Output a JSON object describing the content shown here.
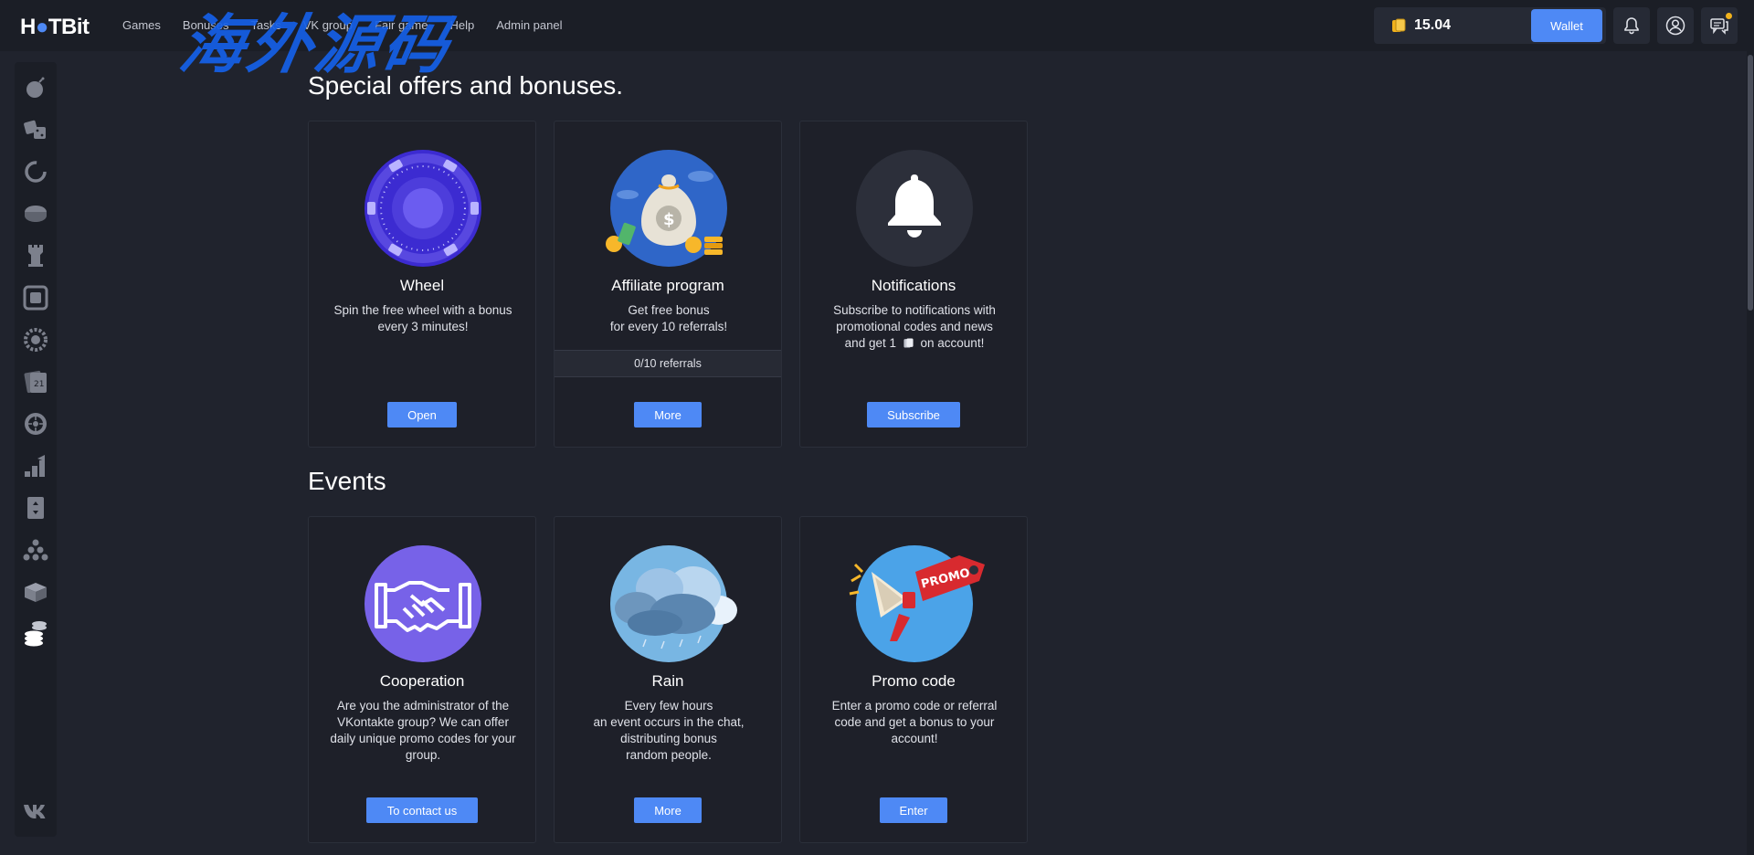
{
  "header": {
    "logo_text_a": "H",
    "logo_text_b": "TBit",
    "nav": [
      "Games",
      "Bonuses",
      "Tasks",
      "VK group",
      "Fair game",
      "Help",
      "Admin panel"
    ],
    "watermark": "海外源码",
    "balance": "15.04",
    "wallet_label": "Wallet",
    "icons": [
      "bell-icon",
      "user-icon",
      "chat-icon"
    ]
  },
  "sidebar": {
    "items": [
      "bomb-icon",
      "dice-icon",
      "crash-icon",
      "coin-icon",
      "tower-icon",
      "keno-icon",
      "wheel-icon",
      "blackjack-icon",
      "roulette-icon",
      "stairs-icon",
      "hilo-icon",
      "plinko-icon",
      "box-icon",
      "coins-icon"
    ],
    "footer": "vk-icon"
  },
  "offers": {
    "title": "Special offers and bonuses.",
    "cards": [
      {
        "title": "Wheel",
        "desc": [
          "Spin the free wheel with a bonus",
          "every 3 minutes!"
        ],
        "button": "Open"
      },
      {
        "title": "Affiliate program",
        "desc": [
          "Get free bonus",
          "for every 10 referrals!"
        ],
        "progress": "0/10 referrals",
        "button": "More"
      },
      {
        "title": "Notifications",
        "desc": [
          "Subscribe to notifications with promotional codes and news",
          "and get 1",
          "on account!"
        ],
        "button": "Subscribe"
      }
    ]
  },
  "events": {
    "title": "Events",
    "cards": [
      {
        "title": "Cooperation",
        "desc": [
          "Are you the administrator of the VKontakte group? We can offer daily unique promo codes for your group."
        ],
        "button": "To contact us"
      },
      {
        "title": "Rain",
        "desc": [
          "Every few hours",
          "an event occurs in the chat, distributing bonus",
          "random people."
        ],
        "button": "More"
      },
      {
        "title": "Promo code",
        "desc": [
          "Enter a promo code or referral code and get a bonus to your account!"
        ],
        "button": "Enter",
        "promo_tag": "PROMO"
      }
    ]
  },
  "colors": {
    "accent": "#4e89f5",
    "bg": "#20232d",
    "card": "#1e2029"
  }
}
